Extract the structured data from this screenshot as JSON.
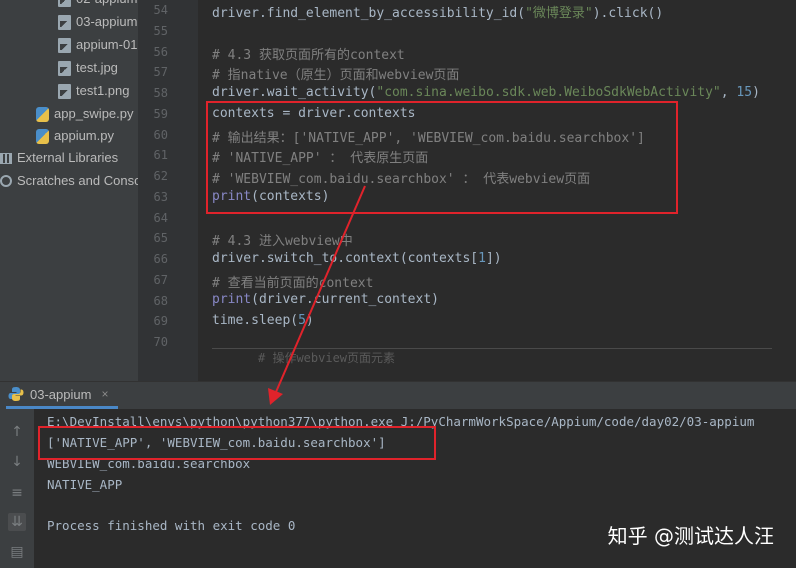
{
  "project_tree": [
    {
      "label": "02-appium",
      "icon": "image-file-icon"
    },
    {
      "label": "03-appium",
      "icon": "image-file-icon"
    },
    {
      "label": "appium-01",
      "icon": "image-file-icon"
    },
    {
      "label": "test.jpg",
      "icon": "image-file-icon"
    },
    {
      "label": "test1.png",
      "icon": "image-file-icon"
    },
    {
      "label": "app_swipe.py",
      "icon": "python-file-icon"
    },
    {
      "label": "appium.py",
      "icon": "python-file-icon"
    },
    {
      "label": "External Libraries",
      "icon": "library-icon"
    },
    {
      "label": "Scratches and Conso",
      "icon": "scratches-icon"
    }
  ],
  "line_numbers": [
    "54",
    "55",
    "56",
    "57",
    "58",
    "59",
    "60",
    "61",
    "62",
    "63",
    "64",
    "65",
    "66",
    "67",
    "68",
    "69",
    "70"
  ],
  "code": {
    "l54_a": "driver.find_element_by_accessibility_id(",
    "l54_str": "\"微博登录\"",
    "l54_b": ").click()",
    "l56": "# 4.3 获取页面所有的context",
    "l57": "# 指native（原生）页面和webview页面",
    "l58_a": "driver.wait_activity(",
    "l58_str": "\"com.sina.weibo.sdk.web.WeiboSdkWebActivity\"",
    "l58_b": ", ",
    "l58_num": "15",
    "l58_c": ")",
    "l59": "contexts = driver.contexts",
    "l60": "# 输出结果：['NATIVE_APP', 'WEBVIEW_com.baidu.searchbox']",
    "l61": "# 'NATIVE_APP' ： 代表原生页面",
    "l62": "# 'WEBVIEW_com.baidu.searchbox' ： 代表webview页面",
    "l63_kw": "print",
    "l63_b": "(contexts)",
    "l65": "# 4.3 进入webview中",
    "l66_a": "driver.switch_to.context(contexts[",
    "l66_num": "1",
    "l66_b": "])",
    "l67": "# 查看当前页面的context",
    "l68_kw": "print",
    "l68_b": "(driver.current_context)",
    "l69_a": "time.sleep(",
    "l69_num": "5",
    "l69_b": ")",
    "l71": "# 操作webview页面元素"
  },
  "run_panel": {
    "tab_label": "03-appium",
    "close_label": "×",
    "output": [
      "E:\\DevInstall\\envs\\python\\python377\\python.exe J:/PyCharmWorkSpace/Appium/code/day02/03-appium",
      "['NATIVE_APP', 'WEBVIEW_com.baidu.searchbox']",
      "WEBVIEW_com.baidu.searchbox",
      "NATIVE_APP",
      "",
      "Process finished with exit code 0"
    ]
  },
  "watermark": "知乎 @测试达人汪",
  "colors": {
    "highlight_box": "#e0232b",
    "editor_bg": "#2b2b2b",
    "panel_bg": "#3c3f41"
  }
}
